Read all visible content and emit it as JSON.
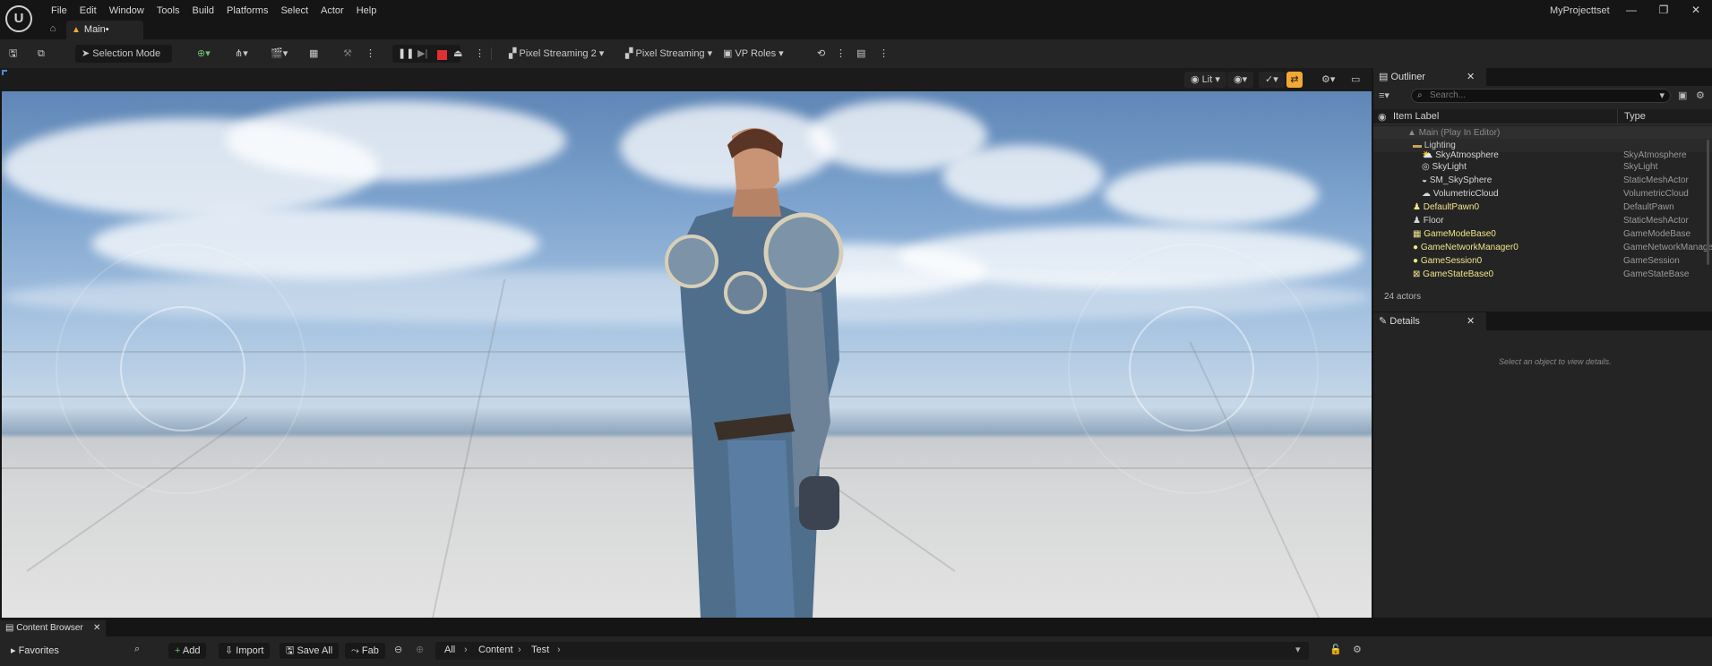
{
  "menu": {
    "items": [
      "File",
      "Edit",
      "Window",
      "Tools",
      "Build",
      "Platforms",
      "Select",
      "Actor",
      "Help"
    ]
  },
  "tab": {
    "label": "Main•"
  },
  "project_title": "MyProjecttset",
  "toolbar": {
    "selection_mode": "Selection Mode",
    "pixel_streaming_2": "Pixel Streaming 2",
    "pixel_streaming": "Pixel Streaming",
    "vp_roles": "VP Roles"
  },
  "viewport": {
    "lit_label": "Lit"
  },
  "outliner": {
    "tab_label": "Outliner",
    "search_placeholder": "Search...",
    "col_label": "Item Label",
    "col_type": "Type",
    "rows": [
      {
        "label": "Main (Play In Editor)",
        "type": ""
      },
      {
        "label": "Lighting",
        "type": ""
      },
      {
        "label": "SkyAtmosphere",
        "type": "SkyAtmosphere"
      },
      {
        "label": "SkyLight",
        "type": "SkyLight"
      },
      {
        "label": "SM_SkySphere",
        "type": "StaticMeshActor"
      },
      {
        "label": "VolumetricCloud",
        "type": "VolumetricCloud"
      },
      {
        "label": "DefaultPawn0",
        "type": "DefaultPawn"
      },
      {
        "label": "Floor",
        "type": "StaticMeshActor"
      },
      {
        "label": "GameModeBase0",
        "type": "GameModeBase"
      },
      {
        "label": "GameNetworkManager0",
        "type": "GameNetworkManager"
      },
      {
        "label": "GameSession0",
        "type": "GameSession"
      },
      {
        "label": "GameStateBase0",
        "type": "GameStateBase"
      }
    ],
    "actor_count": "24 actors"
  },
  "details": {
    "tab_label": "Details",
    "empty_text": "Select an object to view details."
  },
  "content_browser": {
    "tab_label": "Content Browser",
    "favorites": "Favorites",
    "add": "Add",
    "import": "Import",
    "save_all": "Save All",
    "fab": "Fab",
    "breadcrumb": [
      "All",
      "Content",
      "Test"
    ]
  },
  "colors": {
    "accent": "#f2a832",
    "yellow_label": "#f0e58a",
    "stop": "#e03030"
  }
}
